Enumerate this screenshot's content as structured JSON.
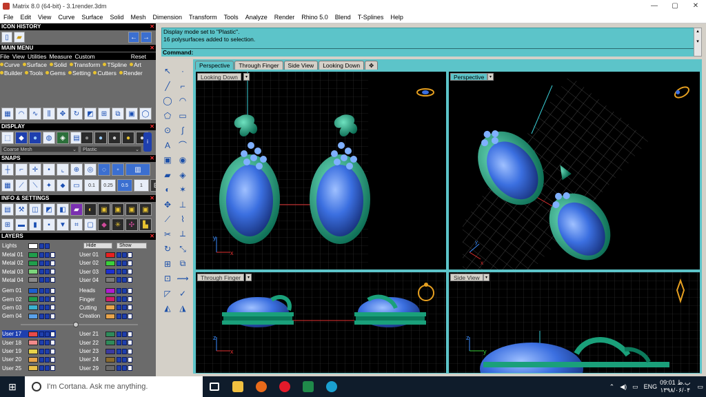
{
  "window": {
    "title": "Matrix 8.0 (64-bit) - 3.1render.3dm",
    "min": "—",
    "max": "▢",
    "close": "✕"
  },
  "menu": [
    "File",
    "Edit",
    "View",
    "Curve",
    "Surface",
    "Solid",
    "Mesh",
    "Dimension",
    "Transform",
    "Tools",
    "Analyze",
    "Render",
    "Rhino 5.0",
    "Blend",
    "T-Splines",
    "Help"
  ],
  "panels": {
    "icon_history": "ICON HISTORY",
    "main_menu": "MAIN MENU",
    "main_menu_row1": [
      "File",
      "View",
      "Utilities",
      "Measure",
      "Custom",
      "Reset"
    ],
    "main_menu_row2": [
      "Curve",
      "Surface",
      "Solid",
      "Transform",
      "TSpline",
      "Art"
    ],
    "main_menu_row3": [
      "Builder",
      "Tools",
      "Gems",
      "Setting",
      "Cutters",
      "Render"
    ],
    "display": "DISPLAY",
    "display_mode_left": "Coarse Mesh",
    "display_mode_right": "Plastic",
    "snaps": "SNAPS",
    "snap_values": [
      "0.1",
      "0.25",
      "0.5",
      "1"
    ],
    "info": "INFO & SETTINGS",
    "layers": "LAYERS",
    "lights": "Lights",
    "hide": "Hide",
    "show": "Show"
  },
  "layers_left": [
    {
      "name": "Metal 01",
      "color": "#1f9e4b"
    },
    {
      "name": "Metal 02",
      "color": "#1f9e4b"
    },
    {
      "name": "Metal 03",
      "color": "#7cd67c"
    },
    {
      "name": "Metal 04",
      "color": "#8a8a8a"
    },
    {
      "name": "Gem 01",
      "color": "#1c5fd0"
    },
    {
      "name": "Gem 02",
      "color": "#1f9e4b"
    },
    {
      "name": "Gem 03",
      "color": "#3ab2d0"
    },
    {
      "name": "Gem 04",
      "color": "#5aa0e8"
    },
    {
      "name": "User 17",
      "color": "#e84a4a"
    },
    {
      "name": "User 18",
      "color": "#f28a8a"
    },
    {
      "name": "User 19",
      "color": "#e8d34a"
    },
    {
      "name": "User 20",
      "color": "#e8a44a"
    },
    {
      "name": "User 25",
      "color": "#e8c04a"
    }
  ],
  "layers_right": [
    {
      "name": "User 01",
      "color": "#e82020"
    },
    {
      "name": "User 02",
      "color": "#3ad03a"
    },
    {
      "name": "User 03",
      "color": "#1c2fd0"
    },
    {
      "name": "User 04",
      "color": "#7a7a7a"
    },
    {
      "name": "Heads",
      "color": "#b01cd0"
    },
    {
      "name": "Finger",
      "color": "#d01c6a"
    },
    {
      "name": "Cutting",
      "color": "#e8a44a"
    },
    {
      "name": "Creation",
      "color": "#e8a44a"
    },
    {
      "name": "User 21",
      "color": "#2e8a5a"
    },
    {
      "name": "User 22",
      "color": "#2e8a5a"
    },
    {
      "name": "User 23",
      "color": "#3a3aa0"
    },
    {
      "name": "User 24",
      "color": "#8a6a2e"
    },
    {
      "name": "User 29",
      "color": "#6a6a6a"
    }
  ],
  "command": {
    "line1": "Display mode set to \"Plastic\".",
    "line2": "16 polysurfaces added to selection.",
    "prompt": "Command:"
  },
  "tabs": [
    "Perspective",
    "Through Finger",
    "Side View",
    "Looking Down"
  ],
  "viewports": {
    "tl": "Looking Down",
    "tr": "Perspective",
    "bl": "Through Finger",
    "br": "Side View"
  },
  "axes": {
    "x": "x",
    "y": "y",
    "z": "z"
  },
  "taskbar": {
    "search": "I'm Cortana. Ask me anything.",
    "lang": "ENG",
    "time": "09:01 ب.ظ",
    "date": "۱۳۹۸/۰۶/۰۴"
  },
  "colors": {
    "teal": "#5cc4c9",
    "metal": "#1aa07a",
    "gem": "#3b6fe0"
  }
}
